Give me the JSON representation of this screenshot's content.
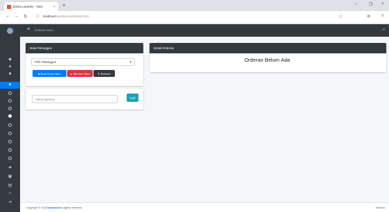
{
  "browser": {
    "tab_title": "Dama Laundry - Dasi",
    "tab_close": "×",
    "new_tab": "+",
    "url_host": "localhost",
    "url_path": "/app/laundry/kelanjt.html",
    "win_min": "–",
    "win_restore": "❐",
    "win_close": "×"
  },
  "navbar": {
    "title": "Orderan Baru"
  },
  "sidebar": {
    "items": [
      "home",
      "user",
      "folder",
      "cart",
      "o1",
      "o2",
      "o3",
      "o4",
      "o5",
      "o6",
      "o7",
      "o8",
      "o9",
      "book",
      "money1",
      "money2",
      "search",
      "arrow"
    ]
  },
  "data_pelanggan": {
    "header": "Data Pelanggan",
    "select_value": "Pilih Pelanggan",
    "btn_order": "Buat Order Baru",
    "btn_member": "Member Baru",
    "btn_refresh": "Refresh"
  },
  "layanan": {
    "placeholder": "nama layanan",
    "btn_cari": "Cari"
  },
  "detail_orderan": {
    "header": "Detail Orderan",
    "empty_message": "Orderan Belum Ada"
  },
  "footer": {
    "prefix": "Copyright © 2022 ",
    "brand": "Xaxibode",
    "suffix": " All rights reserved.",
    "version": "Version"
  },
  "colors": {
    "primary": "#007bff",
    "danger": "#dc3545",
    "dark": "#343a40",
    "info": "#17a2b8"
  }
}
